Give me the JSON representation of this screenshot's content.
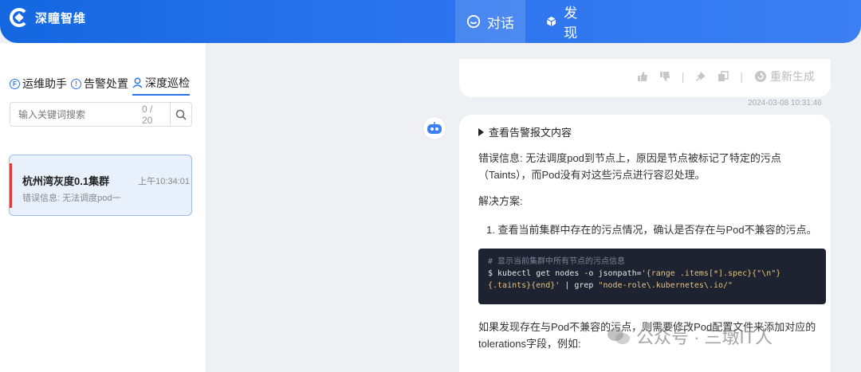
{
  "header": {
    "app_name": "深瞳智维",
    "nav": [
      {
        "label": "对话",
        "icon": "chat-bubble-icon",
        "active": true
      },
      {
        "label": "发现",
        "icon": "cube-icon",
        "active": false
      }
    ]
  },
  "sidebar": {
    "tabs": [
      {
        "label": "运维助手",
        "icon": "info-circle-icon",
        "active": false
      },
      {
        "label": "告警处置",
        "icon": "alert-circle-icon",
        "active": false
      },
      {
        "label": "深度巡检",
        "icon": "person-pin-icon",
        "active": true
      }
    ],
    "search": {
      "placeholder": "输入关键词搜索",
      "count": "0 / 20"
    },
    "conversations": [
      {
        "title": "杭州湾灰度0.1集群",
        "time": "上午10:34:01",
        "preview": "错误信息: 无法调度pod一"
      }
    ]
  },
  "chat": {
    "actions": {
      "regenerate_label": "重新生成"
    },
    "timestamp": "2024-03-08 10:31:46",
    "message": {
      "details_label": "查看告警报文内容",
      "error_line1": "错误信息: 无法调度pod到节点上，原因是节点被标记了特定的污点",
      "error_line2": "（Taints），而Pod没有对这些污点进行容忍处理。",
      "solution_heading": "解决方案:",
      "step1": "1. 查看当前集群中存在的污点情况，确认是否存在与Pod不兼容的污点。",
      "code": {
        "comment": "# 显示当前集群中所有节点的污点信息",
        "line1_prefix": "$ kubectl get nodes -o jsonpath=",
        "line1_str": "'{range .items[*].spec}{\"\\n\"}",
        "line2_str": "{.taints}{end}'",
        "line2_mid": " | grep ",
        "line2_arg": "\"node-role\\.kubernetes\\.io/\""
      },
      "followup_line1": "如果发现存在与Pod不兼容的污点，则需要修改Pod配置文件来添加对应的",
      "followup_line2": "tolerations字段，例如:"
    }
  },
  "watermark": {
    "text": "公众号 · 三墩IT人"
  },
  "colors": {
    "brand": "#2a73ee",
    "alert_bar": "#e03b3b",
    "code_bg": "#1d2330"
  }
}
